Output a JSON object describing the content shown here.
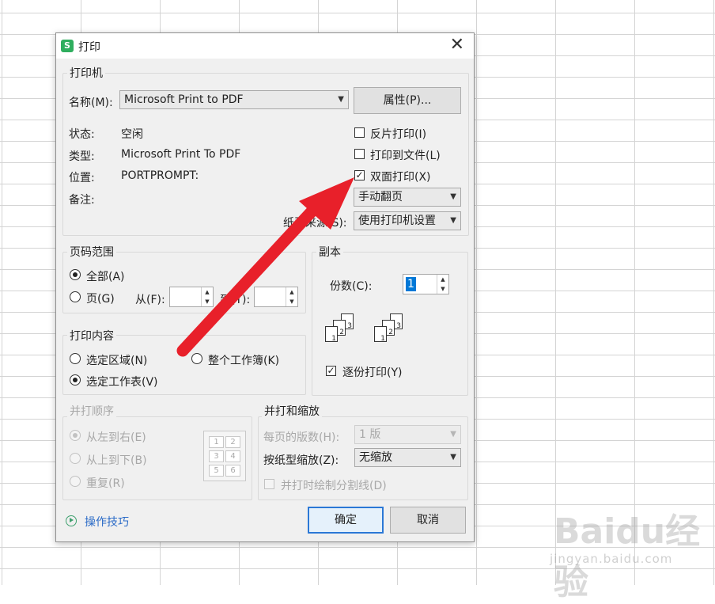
{
  "dialog": {
    "title": "打印",
    "close_symbol": "✕",
    "app_icon_letter": "S",
    "app_icon": "wps-sheet-icon"
  },
  "printer": {
    "group_label": "打印机",
    "name_label": "名称(M):",
    "name_value": "Microsoft Print to PDF",
    "properties_button": "属性(P)...",
    "status_label": "状态:",
    "status_value": "空闲",
    "type_label": "类型:",
    "type_value": "Microsoft Print To PDF",
    "location_label": "位置:",
    "location_value": "PORTPROMPT:",
    "comment_label": "备注:",
    "reverse_print": "反片打印(I)",
    "print_to_file": "打印到文件(L)",
    "duplex_print": "双面打印(X)",
    "duplex_checked": true,
    "duplex_mode": "手动翻页",
    "paper_source_label": "纸张来源(S):",
    "paper_source_value": "使用打印机设置"
  },
  "page_range": {
    "group_label": "页码范围",
    "all": "全部(A)",
    "pages": "页(G)",
    "from_label": "从(F):",
    "to_label": "到(T):"
  },
  "copies": {
    "group_label": "副本",
    "count_label": "份数(C):",
    "count_value": "1",
    "collate": "逐份打印(Y)",
    "page_numbers": [
      "1",
      "2",
      "3"
    ]
  },
  "print_content": {
    "group_label": "打印内容",
    "selection": "选定区域(N)",
    "whole_workbook": "整个工作簿(K)",
    "selected_sheet": "选定工作表(V)"
  },
  "print_order": {
    "group_label": "并打顺序",
    "left_to_right": "从左到右(E)",
    "top_to_bottom": "从上到下(B)",
    "repeat": "重复(R)",
    "cells": [
      "1",
      "2",
      "3",
      "4",
      "5",
      "6"
    ]
  },
  "scaling": {
    "group_label": "并打和缩放",
    "pages_per_sheet_label": "每页的版数(H):",
    "pages_per_sheet_value": "1 版",
    "scale_label": "按纸型缩放(Z):",
    "scale_value": "无缩放",
    "draw_borders": "并打时绘制分割线(D)"
  },
  "footer": {
    "tips": "操作技巧",
    "ok": "确定",
    "cancel": "取消"
  },
  "watermark": {
    "brand": "Baidu经验",
    "url": "jingyan.baidu.com"
  },
  "annotation": {
    "arrow_color": "#e8202a"
  }
}
